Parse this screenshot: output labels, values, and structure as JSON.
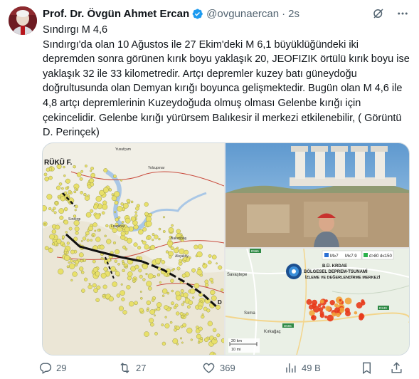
{
  "author": {
    "name": "Prof. Dr. Övgün Ahmet Ercan",
    "handle": "@ovgunaercan",
    "time": "2s",
    "verified_color": "#1d9bf0"
  },
  "tweet": {
    "text": "Sındırgı M 4,6\nSındırgı'da olan 10 Ağustos ile 27 Ekim'deki M 6,1 büyüklüğündeki iki depremden sonra görünen kırık boyu yaklaşık 20, JEOFIZIK örtülü kırık boyu ise yaklaşık 32 ile 33 kilometredir. Artçı depremler kuzey batı güneydoğu doğrultusunda olan Demyan kırığı boyunca gelişmektedir. Bugün olan M 4,6 ile 4,8 artçı depremlerinin Kuzeydoğuda olmuş olması Gelenbe kırığı için çekincelidir. Gelenbe kırığı yürürsem Balıkesir il merkezi etkilenebilir, ( Görüntü D. Perinçek)"
  },
  "media": {
    "map": {
      "labels": [
        "RÜKÜ F.",
        "Yolcupınar",
        "Yusufçam",
        "Loupinar",
        "Sındırgı",
        "Akçaköy",
        "Bakımbaş",
        "D"
      ],
      "fault_color": "#111111",
      "dot_color": "#e8e06a"
    },
    "quake_map": {
      "title_line1": "B.Ü. KRDAE",
      "title_line2": "BÖLGESEL DEPREM-TSUNAMİ",
      "title_line3": "İZLEME VE DEĞERLENDİRME MERKEZİ",
      "legend_m1": "M≥7",
      "legend_m2": "M≤7.9",
      "legend_d": "d>80 d≤150",
      "places": [
        "Savaştepe",
        "Soma",
        "Kırkağaç",
        "Sındırgı"
      ],
      "road_labels": [
        "D565",
        "D240",
        "D565"
      ],
      "scale_km": "20 km",
      "scale_mi": "10 mi",
      "quake_color": "#e83a1a"
    }
  },
  "actions": {
    "replies": "29",
    "retweets": "27",
    "likes": "369",
    "views": "49 B"
  }
}
